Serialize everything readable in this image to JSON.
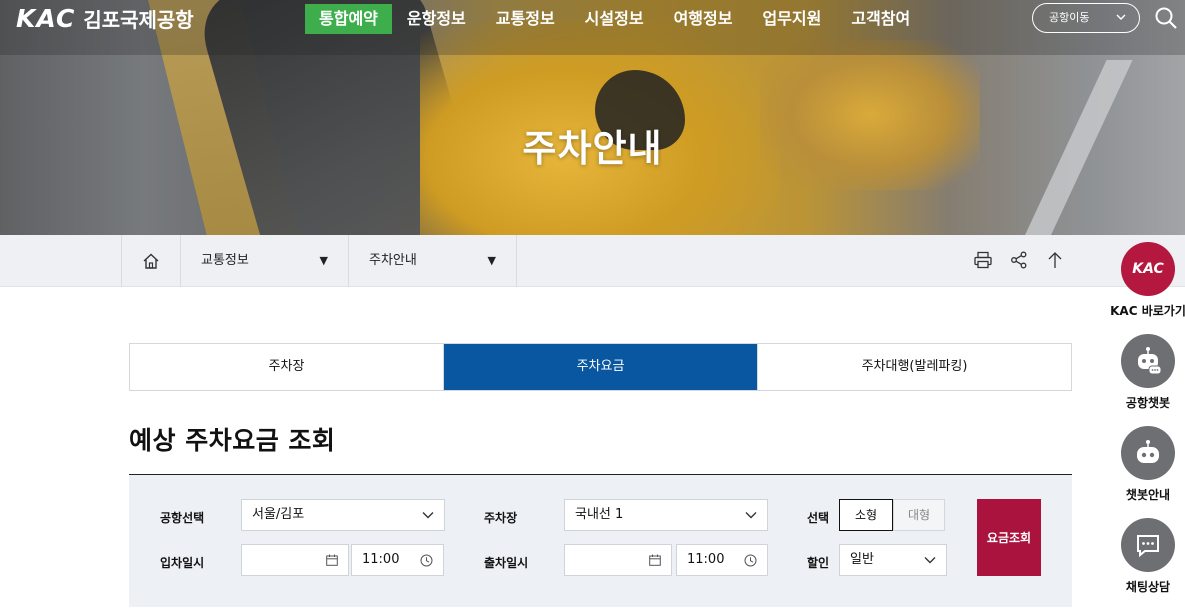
{
  "header": {
    "logo_mark": "KAC",
    "logo_name": "김포국제공항",
    "nav": [
      {
        "label": "통합예약",
        "active": true
      },
      {
        "label": "운항정보"
      },
      {
        "label": "교통정보"
      },
      {
        "label": "시설정보"
      },
      {
        "label": "여행정보"
      },
      {
        "label": "업무지원"
      },
      {
        "label": "고객참여"
      }
    ],
    "airport_move_label": "공항이동",
    "accent_color": "#3eae4d"
  },
  "hero": {
    "title": "주차안내"
  },
  "breadcrumb": {
    "level1": "교통정보",
    "level2": "주차안내",
    "tools": [
      "print-icon",
      "share-icon",
      "arrow-up-icon"
    ]
  },
  "tabs": [
    {
      "label": "주차장",
      "active": false
    },
    {
      "label": "주차요금",
      "active": true
    },
    {
      "label": "주차대행(발레파킹)",
      "active": false
    }
  ],
  "section_title": "예상 주차요금 조회",
  "form": {
    "airport_label": "공항선택",
    "airport_value": "서울/김포",
    "parking_label": "주차장",
    "parking_value": "국내선 1",
    "select_label": "선택",
    "size_small": "소형",
    "size_large": "대형",
    "entry_label": "입차일시",
    "entry_date": "",
    "entry_time": "11:00",
    "exit_label": "출차일시",
    "exit_date": "",
    "exit_time": "11:00",
    "discount_label": "할인",
    "discount_value": "일반",
    "submit_label": "요금조회",
    "submit_color": "#a9133e"
  },
  "quick_menu": [
    {
      "label": "KAC 바로가기",
      "icon": "kac-logo-icon",
      "mark": "KAC"
    },
    {
      "label": "공항챗봇",
      "icon": "chatbot-icon"
    },
    {
      "label": "챗봇안내",
      "icon": "robot-icon"
    },
    {
      "label": "채팅상담",
      "icon": "chat-bubble-icon"
    }
  ],
  "tab_active_color": "#0a57a1"
}
